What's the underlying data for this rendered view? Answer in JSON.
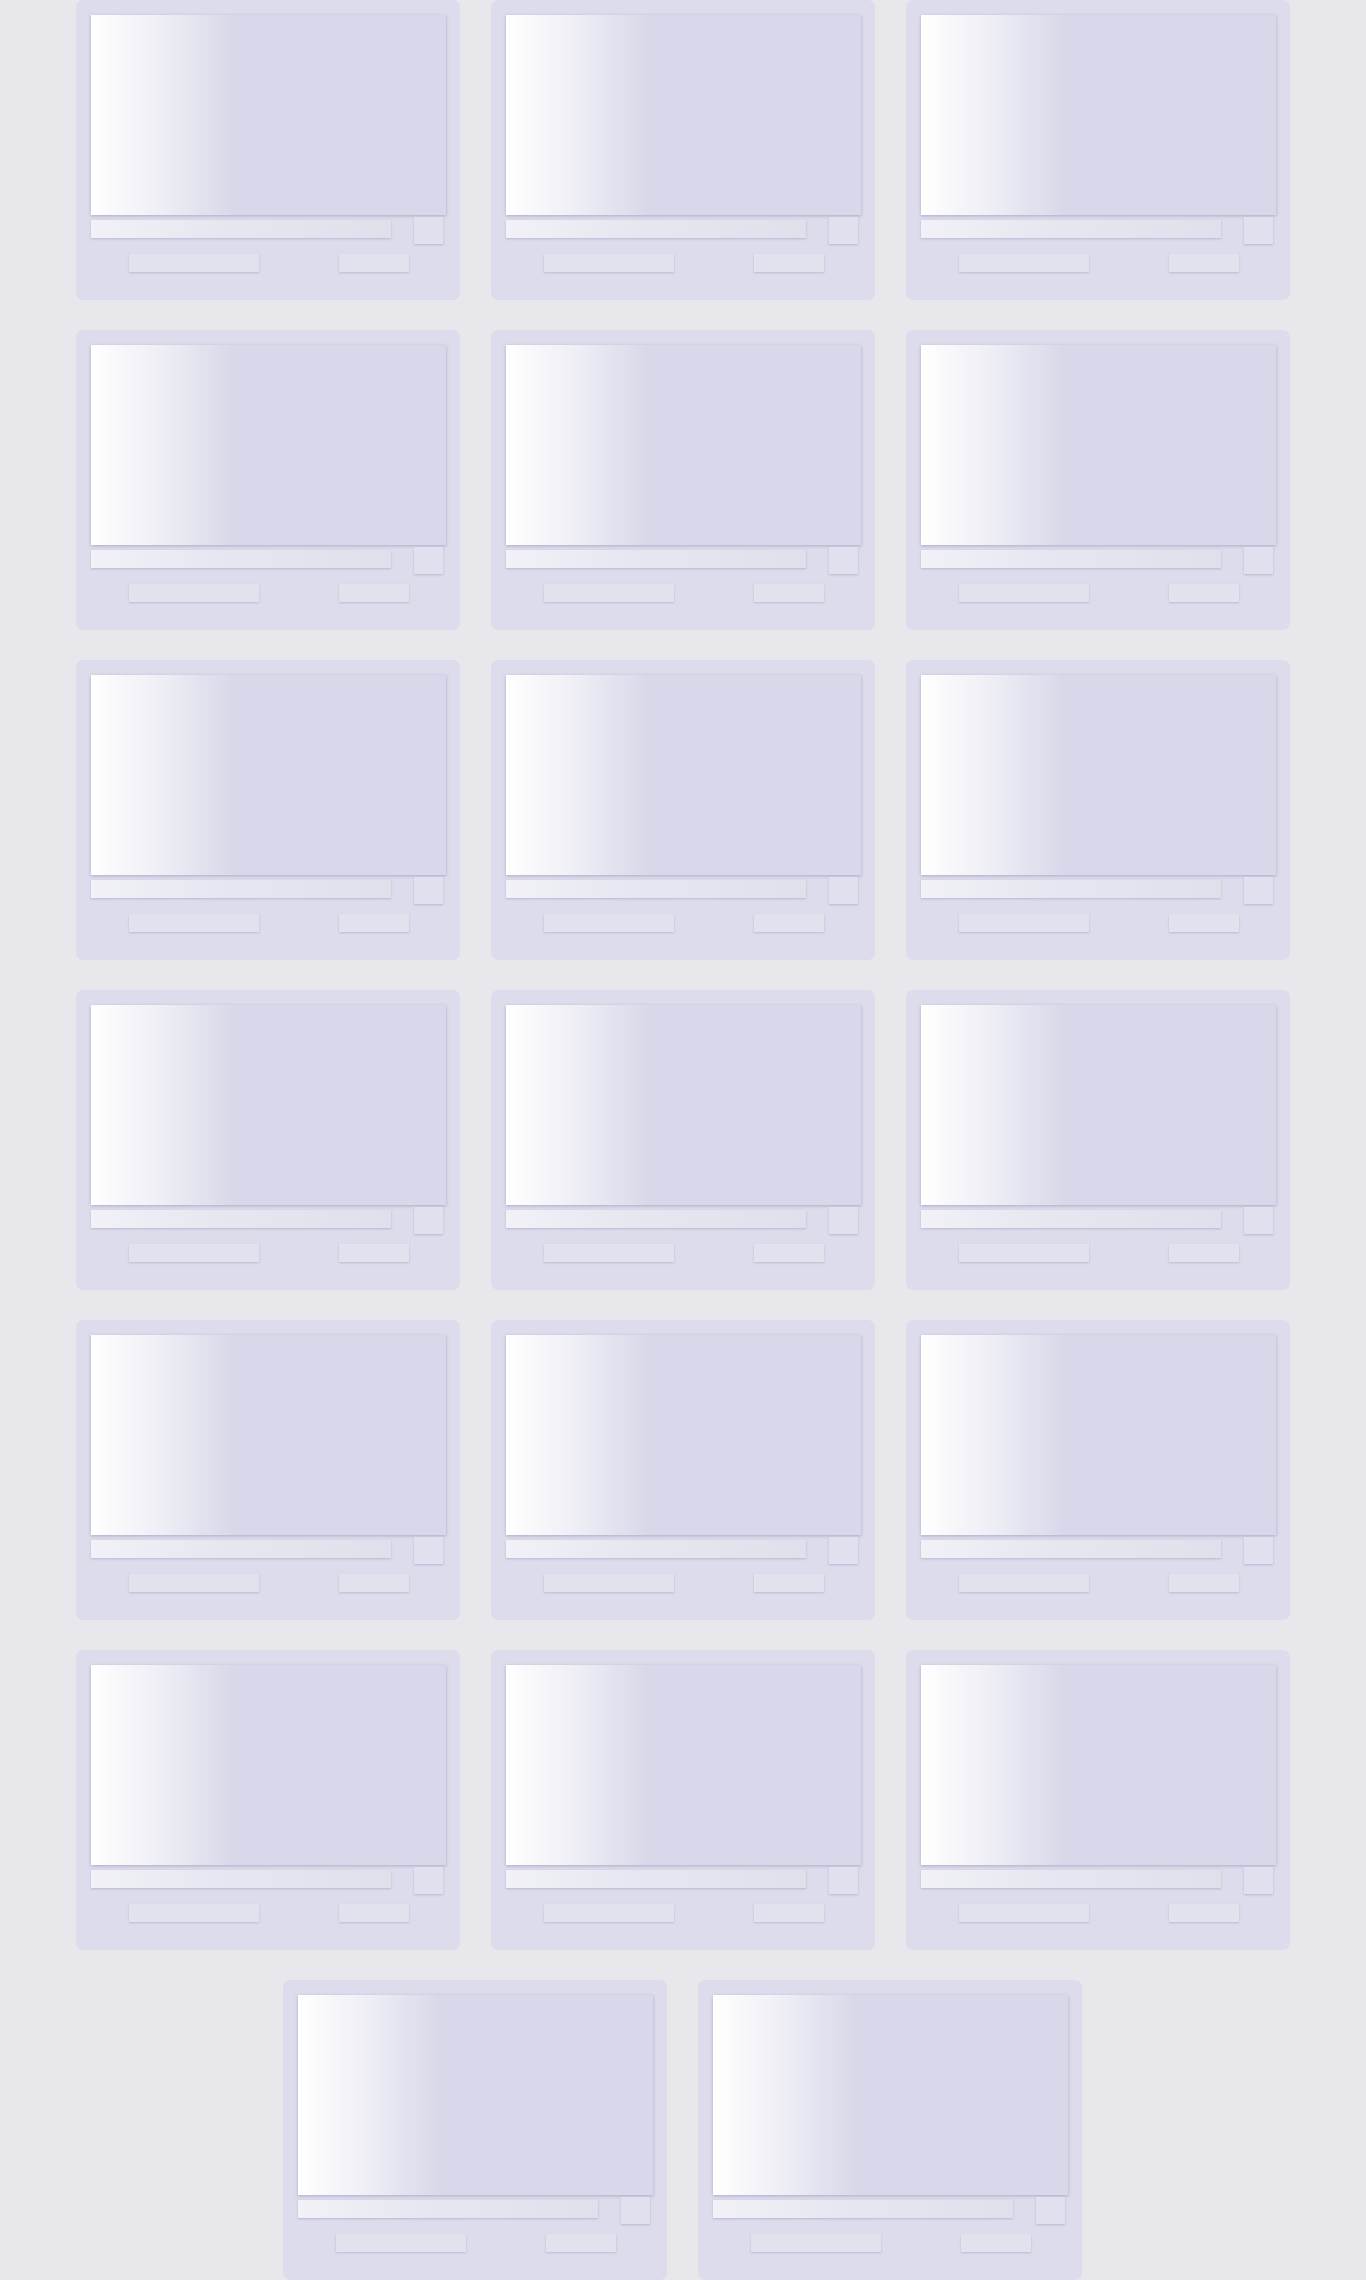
{
  "page": {
    "state": "loading-placeholders",
    "background_color": "#e8e8ec"
  },
  "cards": [
    {},
    {},
    {},
    {},
    {},
    {},
    {},
    {},
    {},
    {},
    {},
    {},
    {},
    {},
    {},
    {},
    {},
    {},
    {},
    {}
  ],
  "colors": {
    "card": "#dcdcec",
    "placeholder": "#e0e0ee",
    "shimmer_highlight": "#ffffff"
  }
}
